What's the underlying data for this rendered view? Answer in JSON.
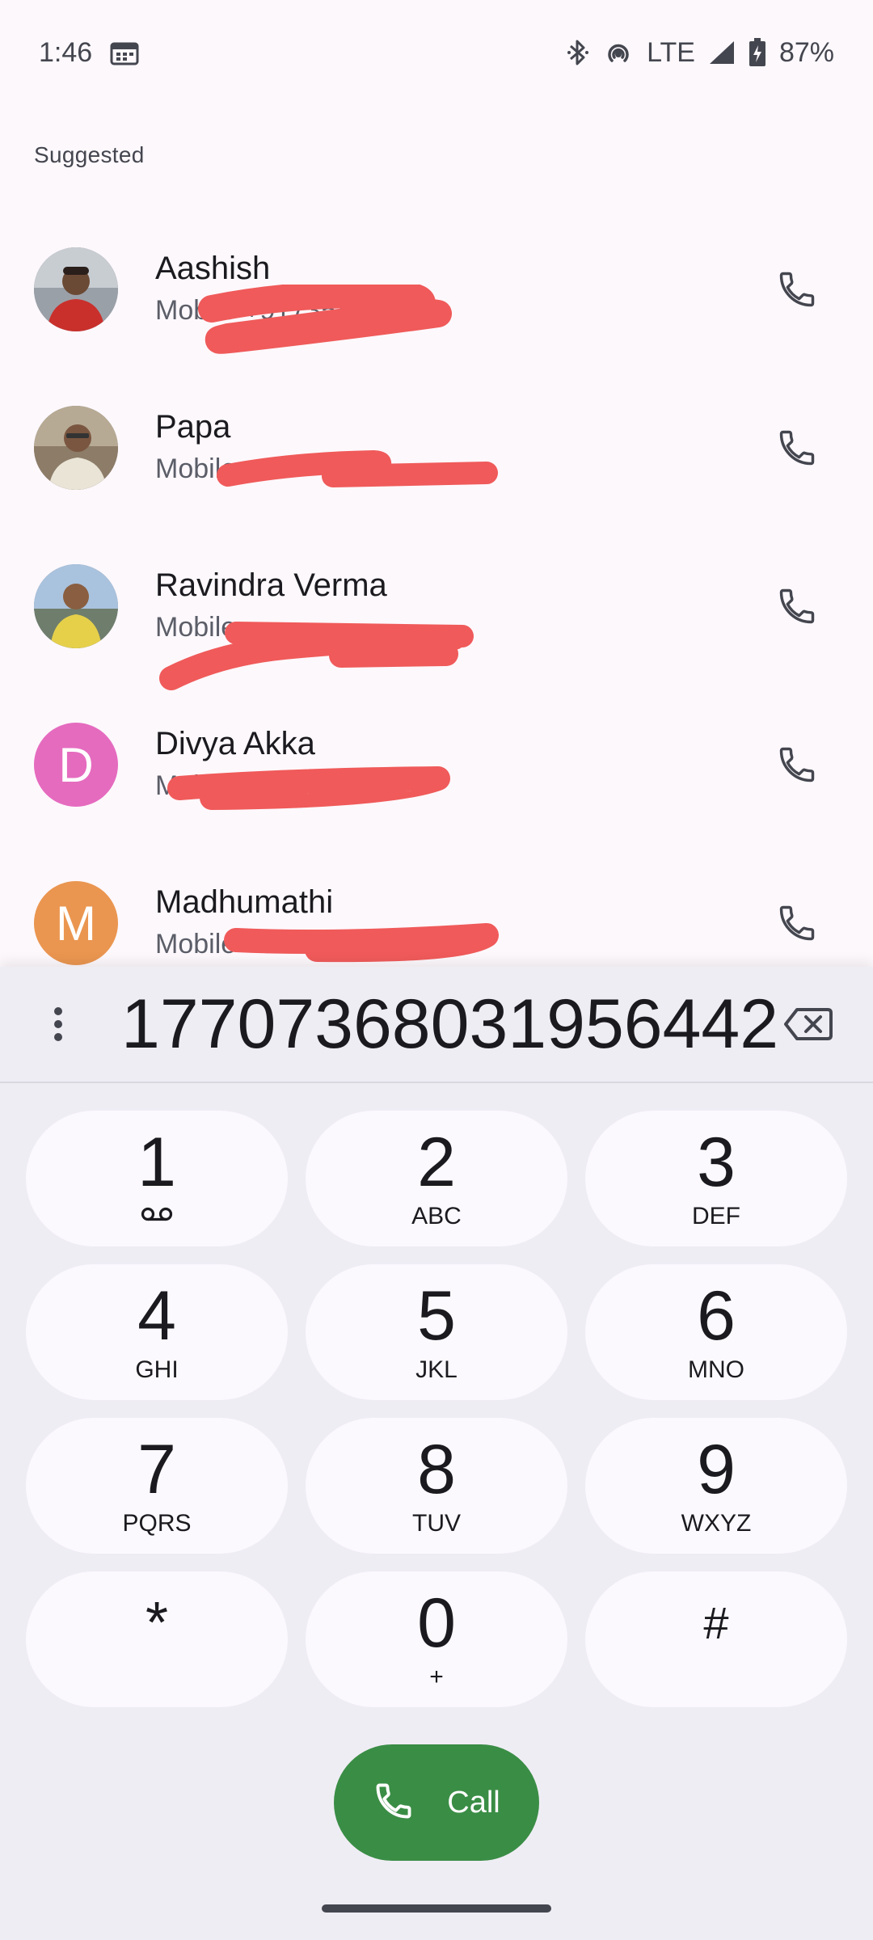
{
  "status_bar": {
    "time": "1:46",
    "network": "LTE",
    "battery": "87%"
  },
  "suggested": {
    "label": "Suggested",
    "contacts": [
      {
        "name": "Aashish",
        "sub": "Mobile +9173580",
        "avatar_type": "photo"
      },
      {
        "name": "Papa",
        "sub": "Mobile",
        "avatar_type": "photo"
      },
      {
        "name": "Ravindra Verma",
        "sub": "Mobile",
        "avatar_type": "photo"
      },
      {
        "name": "Divya Akka",
        "sub": "Mobile",
        "avatar_type": "letter",
        "initial": "D",
        "color": "#e56bbf"
      },
      {
        "name": "Madhumathi",
        "sub": "Mobile +9",
        "avatar_type": "letter",
        "initial": "M",
        "color": "#ea9650"
      }
    ]
  },
  "dialpad": {
    "entered_number": "17707368031956442",
    "keys": [
      {
        "digit": "1",
        "letters": ""
      },
      {
        "digit": "2",
        "letters": "ABC"
      },
      {
        "digit": "3",
        "letters": "DEF"
      },
      {
        "digit": "4",
        "letters": "GHI"
      },
      {
        "digit": "5",
        "letters": "JKL"
      },
      {
        "digit": "6",
        "letters": "MNO"
      },
      {
        "digit": "7",
        "letters": "PQRS"
      },
      {
        "digit": "8",
        "letters": "TUV"
      },
      {
        "digit": "9",
        "letters": "WXYZ"
      },
      {
        "digit": "*",
        "letters": ""
      },
      {
        "digit": "0",
        "letters": "+"
      },
      {
        "digit": "#",
        "letters": ""
      }
    ],
    "call_label": "Call"
  },
  "colors": {
    "accent_call": "#3a8d45",
    "redaction": "#f05a5a"
  },
  "icons": [
    "calendar-icon",
    "bluetooth-icon",
    "hotspot-icon",
    "signal-icon",
    "battery-charging-icon",
    "phone-icon",
    "more-vert-icon",
    "backspace-icon",
    "voicemail-icon"
  ]
}
